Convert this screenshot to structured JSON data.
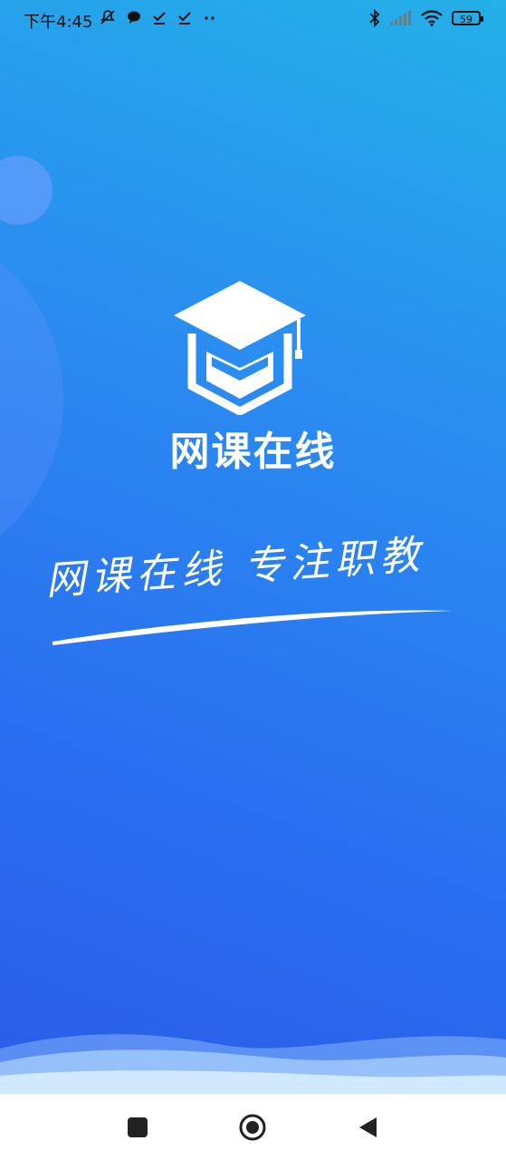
{
  "status_bar": {
    "time": "下午4:45",
    "battery": "59"
  },
  "app": {
    "title": "网课在线",
    "slogan": "网课在线  专注职教"
  },
  "icons": {
    "logo": "graduation-cap-icon",
    "home": "home-circle-icon",
    "recents": "recents-square-icon",
    "back": "back-triangle-icon"
  },
  "colors": {
    "gradient_top": "#24b0e8",
    "gradient_bottom": "#2b5ce8",
    "nav_bg": "#ffffff"
  }
}
